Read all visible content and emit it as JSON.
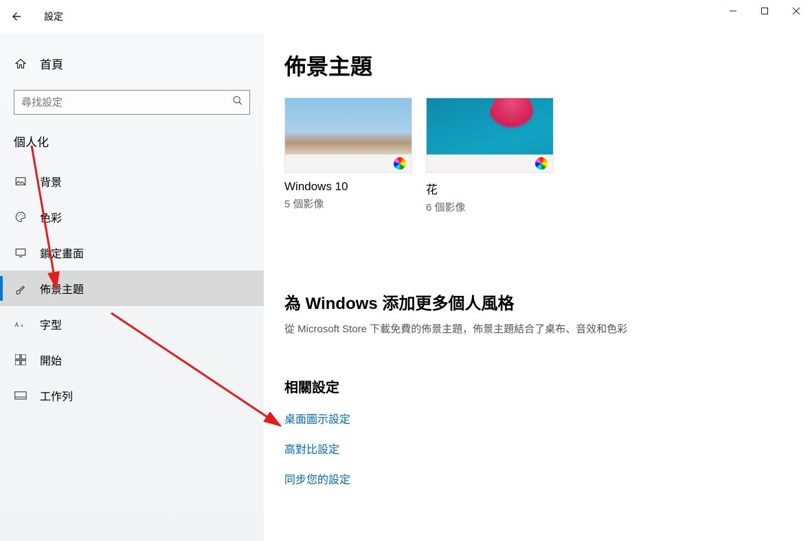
{
  "app": {
    "title": "設定"
  },
  "sidebar": {
    "home": "首頁",
    "search_placeholder": "尋找設定",
    "category": "個人化",
    "items": [
      {
        "label": "背景"
      },
      {
        "label": "色彩"
      },
      {
        "label": "鎖定畫面"
      },
      {
        "label": "佈景主題"
      },
      {
        "label": "字型"
      },
      {
        "label": "開始"
      },
      {
        "label": "工作列"
      }
    ]
  },
  "main": {
    "title": "佈景主題",
    "themes": [
      {
        "name": "Windows 10",
        "sub": "5 個影像"
      },
      {
        "name": "花",
        "sub": "6 個影像"
      }
    ],
    "more_heading": "為 Windows 添加更多個人風格",
    "more_desc": "從 Microsoft Store 下載免費的佈景主題，佈景主題結合了桌布、音效和色彩",
    "related_heading": "相關設定",
    "related_links": [
      "桌面圖示設定",
      "高對比設定",
      "同步您的設定"
    ]
  }
}
